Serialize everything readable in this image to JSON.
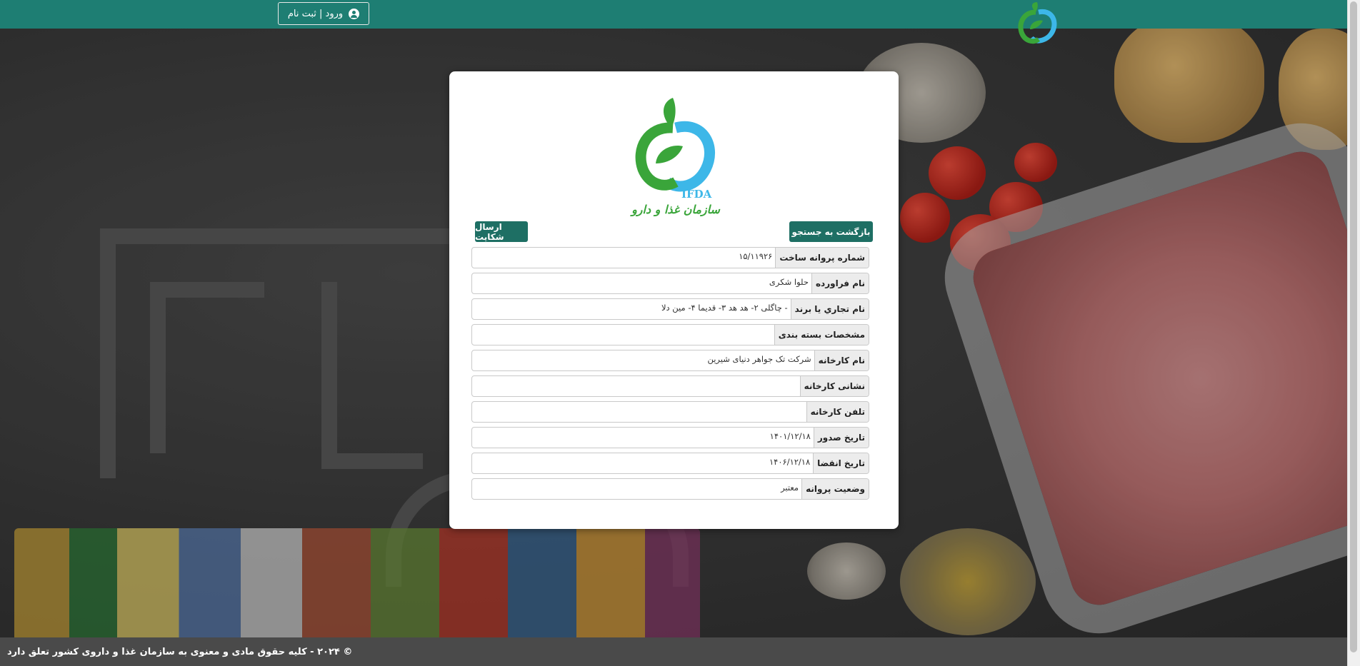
{
  "header": {
    "login_label": "ورود | ثبت نام",
    "login_icon": "user-circle-icon",
    "logo_name": "ifda-logo"
  },
  "card": {
    "logo_text_en": "IFDA",
    "logo_text_fa": "سازمان غذا و دارو",
    "back_button_label": "بازگشت به جستجو",
    "complaint_button_label": "ارسال شکایت",
    "rows": [
      {
        "label": "شماره پروانه ساخت",
        "value": "۱۵/۱۱۹۲۶"
      },
      {
        "label": "نام فراورده",
        "value": "حلوا شکری"
      },
      {
        "label": "نام تجاري يا برند",
        "value": "- چاگلی ۲- هد هد ۳- قدیما ۴- مین دلا"
      },
      {
        "label": "مشخصات بسته بندی",
        "value": ""
      },
      {
        "label": "نام کارخانه",
        "value": "شرکت تک جواهر دنیای شیرین"
      },
      {
        "label": "نشانی کارخانه",
        "value": ""
      },
      {
        "label": "تلفن کارخانه",
        "value": ""
      },
      {
        "label": "تاریخ صدور",
        "value": "۱۴۰۱/۱۲/۱۸"
      },
      {
        "label": "تاریخ انقضا",
        "value": "۱۴۰۶/۱۲/۱۸"
      },
      {
        "label": "وضعیت پروانه",
        "value": "معتبر"
      }
    ]
  },
  "footer": {
    "copyright": "© ۲۰۲۴ - کلیه حقوق مادی و معنوی به سازمان غذا و داروی کشور تعلق دارد"
  },
  "colors": {
    "header_bg": "#1e7e73",
    "button_bg": "#1e6f64",
    "footer_bg": "#4a4a4a",
    "logo_green": "#3aa53a",
    "logo_blue": "#3db7e8"
  }
}
